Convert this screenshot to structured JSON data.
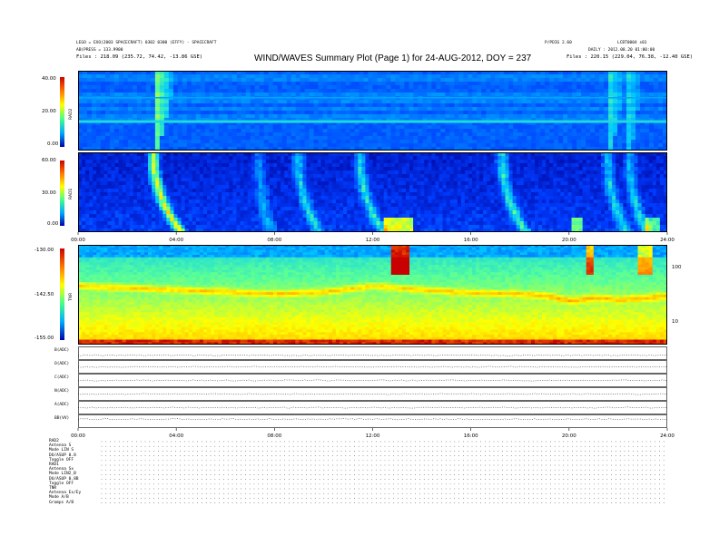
{
  "header": {
    "title": "WIND/WAVES Summary Plot (Page 1) for 24-AUG-2012, DOY = 237",
    "left_line1": "LEGO = EXO(2003 SPACECRAFT) 0302 0300 (EFFY) - SPACECRAFT",
    "left_line2": "AB(PRESS = 133.9900",
    "left_line3": "Files : 218.09 (235.72, 74.42, -13.86 GSE)",
    "right_top": "LCBT0004 s01",
    "mid_top": "P/PDIG 2.60",
    "right_line2": "DAILY : 2012.08.20 01:00:00",
    "right_line3": "Files : 220.15 (229.04, 76.38, -12.40 GSE)",
    "rad2_ticks": [
      "40.00",
      "20.00",
      "0.00"
    ],
    "rad1_ticks": [
      "60.00",
      "30.00",
      "0.00"
    ],
    "tnr_ticks": [
      "-130.00",
      "-142.50",
      "-155.00"
    ],
    "panel_labels": [
      "RAD2",
      "RAD1",
      "TNR"
    ],
    "time_ticks": [
      "00:00",
      "04:00",
      "08:00",
      "12:00",
      "16:00",
      "20:00",
      "24:00"
    ],
    "right_freq_ticks": [
      "100",
      "10"
    ],
    "trace_labels": [
      "B(ADC)",
      "O(ADC)",
      "C(ADC)",
      "N(ADC)",
      "A(ADC)",
      "BB(VV)"
    ],
    "bottom_block": [
      "RAD2",
      "Antenna   S",
      "Mode    LIN S",
      "DU/ASUP  0.8",
      "Toggle    OFF",
      "RAD1",
      "Antenna   Sx",
      "Mode  LIN2_B",
      "DU/ASUP 0.8B",
      "Toggle    OFF",
      "TNR",
      "Antenna  Ex/Ey",
      "Mode    A/B",
      "Gramps   A/B"
    ]
  },
  "chart_data": [
    {
      "type": "heatmap",
      "title": "RAD2",
      "xlabel": "",
      "ylabel": "RAD2",
      "xlim": [
        0,
        24
      ],
      "ylim": [
        0,
        40
      ],
      "colorbar_ticks": [
        40.0,
        20.0,
        0.0
      ],
      "colormap": [
        "#0000aa",
        "#00aaff",
        "#44ff88",
        "#ffff00",
        "#ff7700",
        "#cc0000"
      ],
      "bursts": [
        {
          "time": 3.0,
          "strength": 0.85,
          "decay": 0.8
        },
        {
          "time": 21.5,
          "strength": 0.5,
          "decay": 0.6
        },
        {
          "time": 22.3,
          "strength": 0.4,
          "decay": 0.5
        }
      ],
      "noise_bands": [
        0.05,
        0.1,
        0.28,
        0.32,
        0.36,
        0.45,
        0.55,
        0.6
      ]
    },
    {
      "type": "heatmap",
      "title": "RAD1",
      "xlabel": "",
      "ylabel": "RAD1",
      "xlim": [
        0,
        24
      ],
      "ylim": [
        0,
        60
      ],
      "colorbar_ticks": [
        60.0,
        30.0,
        0.0
      ],
      "bursts": [
        {
          "time": 3.0,
          "strength": 1.0,
          "decay": 1.2
        },
        {
          "time": 7.3,
          "strength": 0.35,
          "decay": 0.5
        },
        {
          "time": 8.9,
          "strength": 0.55,
          "decay": 0.9
        },
        {
          "time": 11.4,
          "strength": 0.6,
          "decay": 1.0
        },
        {
          "time": 17.2,
          "strength": 0.65,
          "decay": 1.0
        },
        {
          "time": 21.5,
          "strength": 0.55,
          "decay": 0.8
        },
        {
          "time": 22.4,
          "strength": 0.5,
          "decay": 0.7
        }
      ],
      "patches": [
        {
          "time": 13.0,
          "width": 1.2,
          "strength": 0.8
        },
        {
          "time": 20.2,
          "width": 0.4,
          "strength": 0.6
        },
        {
          "time": 23.3,
          "width": 0.6,
          "strength": 0.55
        }
      ]
    },
    {
      "type": "heatmap",
      "title": "TNR",
      "xlabel": "",
      "ylabel": "TNR",
      "xlim": [
        0,
        24
      ],
      "colorbar_ticks": [
        -130.0,
        -142.5,
        -155.0
      ],
      "right_axis_ticks": [
        100,
        10
      ],
      "plasma_line": [
        [
          0,
          0.4
        ],
        [
          2,
          0.42
        ],
        [
          4,
          0.44
        ],
        [
          6,
          0.46
        ],
        [
          8,
          0.48
        ],
        [
          10,
          0.46
        ],
        [
          12,
          0.4
        ],
        [
          13,
          0.42
        ],
        [
          14,
          0.44
        ],
        [
          16,
          0.47
        ],
        [
          18,
          0.48
        ],
        [
          19,
          0.5
        ],
        [
          20,
          0.55
        ],
        [
          21,
          0.52
        ],
        [
          22,
          0.54
        ],
        [
          24,
          0.5
        ]
      ],
      "patches": [
        {
          "time": 13.1,
          "width": 0.8,
          "strength": 1.0
        },
        {
          "time": 20.8,
          "width": 0.3,
          "strength": 0.7
        },
        {
          "time": 23.0,
          "width": 0.6,
          "strength": 0.5
        }
      ]
    },
    {
      "type": "line",
      "title": "traces",
      "series": [
        {
          "name": "B(ADC)",
          "level": 0.35
        },
        {
          "name": "O(ADC)",
          "level": 0.5
        },
        {
          "name": "C(ADC)",
          "level": 0.5
        },
        {
          "name": "N(ADC)",
          "level": 0.5
        },
        {
          "name": "A(ADC)",
          "level": 0.5
        },
        {
          "name": "BB(VV)",
          "level": 0.65
        }
      ]
    }
  ]
}
